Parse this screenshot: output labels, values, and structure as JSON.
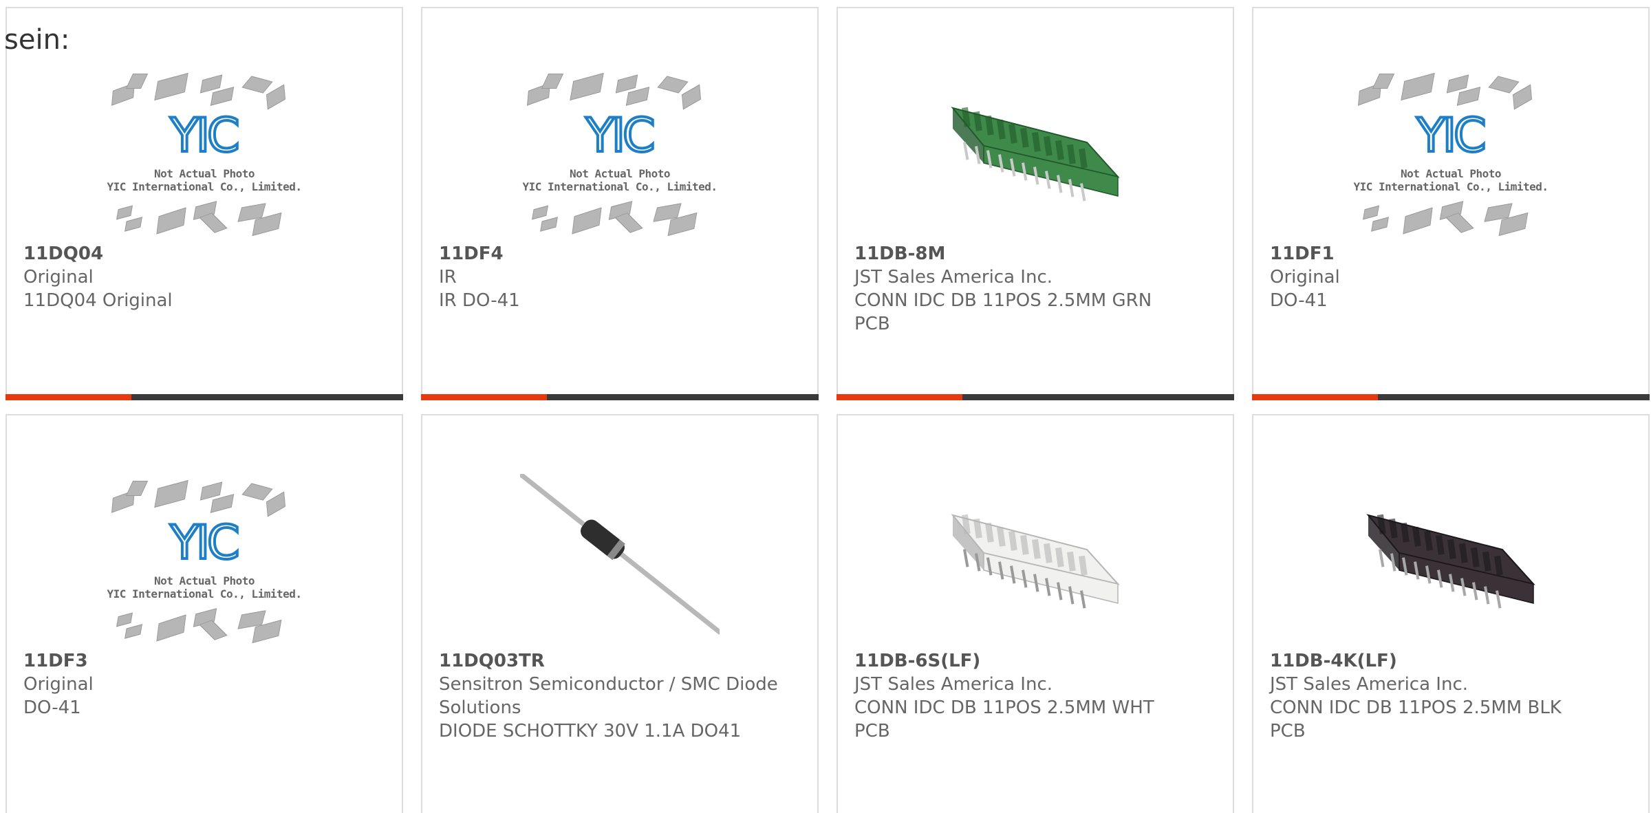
{
  "lead_text": "sein:",
  "placeholder": {
    "logo": "YIC",
    "caption1": "Not Actual Photo",
    "caption2": "YIC International Co., Limited."
  },
  "colors": {
    "accent": "#e8380d",
    "bar": "#3a3a3a",
    "border": "#dddddd",
    "logo_blue": "#1e7fc6"
  },
  "products": [
    {
      "pn": "11DQ04",
      "mfr": "Original",
      "desc": "11DQ04 Original",
      "image": "yic-placeholder"
    },
    {
      "pn": "11DF4",
      "mfr": "IR",
      "desc": "IR DO-41",
      "image": "yic-placeholder"
    },
    {
      "pn": "11DB-8M",
      "mfr": "JST Sales America Inc.",
      "desc": "CONN IDC DB 11POS 2.5MM GRN PCB",
      "image": "green-connector"
    },
    {
      "pn": "11DF1",
      "mfr": "Original",
      "desc": "DO-41",
      "image": "yic-placeholder"
    },
    {
      "pn": "11DF3",
      "mfr": "Original",
      "desc": "DO-41",
      "image": "yic-placeholder"
    },
    {
      "pn": "11DQ03TR",
      "mfr": "Sensitron Semiconductor / SMC Diode Solutions",
      "desc": "DIODE SCHOTTKY 30V 1.1A DO41",
      "image": "axial-diode"
    },
    {
      "pn": "11DB-6S(LF)",
      "mfr": "JST Sales America Inc.",
      "desc": "CONN IDC DB 11POS 2.5MM WHT PCB",
      "image": "white-connector"
    },
    {
      "pn": "11DB-4K(LF)",
      "mfr": "JST Sales America Inc.",
      "desc": "CONN IDC DB 11POS 2.5MM BLK PCB",
      "image": "black-connector"
    }
  ]
}
